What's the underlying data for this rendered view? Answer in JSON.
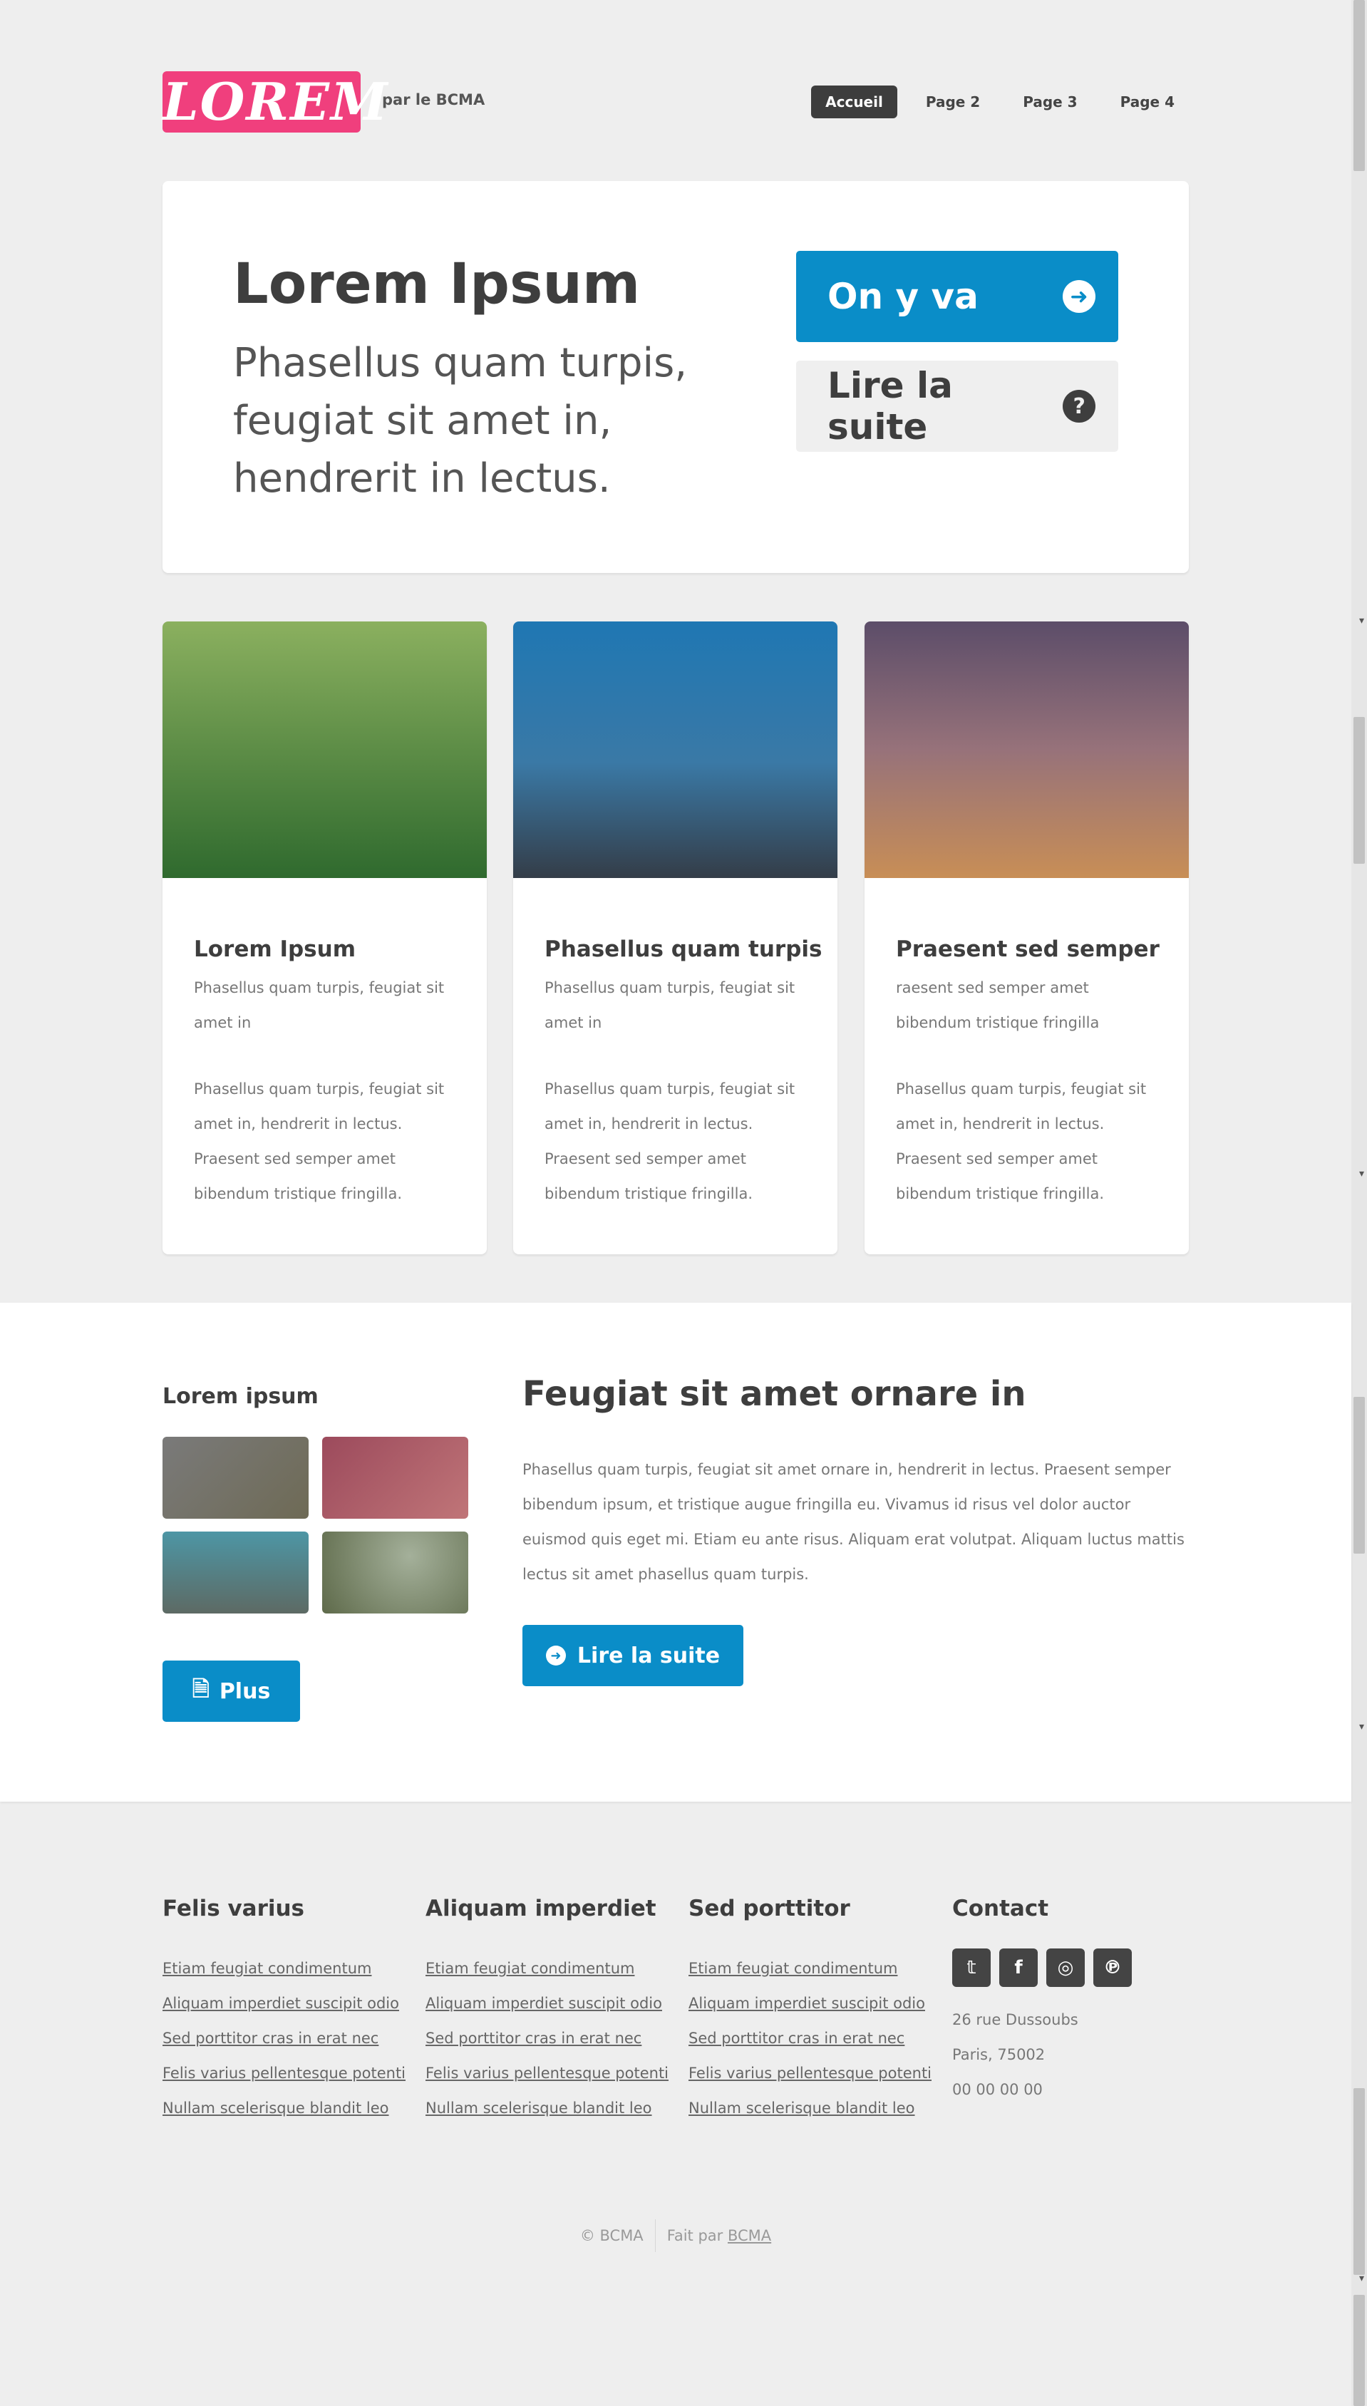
{
  "header": {
    "logo": "LOREM",
    "tagline": "par le BCMA",
    "nav": [
      {
        "label": "Accueil",
        "active": true
      },
      {
        "label": "Page 2",
        "active": false
      },
      {
        "label": "Page 3",
        "active": false
      },
      {
        "label": "Page 4",
        "active": false
      }
    ]
  },
  "hero": {
    "title": "Lorem Ipsum",
    "subtitle": "Phasellus quam turpis, feugiat sit amet in, hendrerit in lectus.",
    "primary_button": "On y va",
    "secondary_button": "Lire la suite"
  },
  "cards": [
    {
      "title": "Lorem Ipsum",
      "subtitle": "Phasellus quam turpis, feugiat sit amet in",
      "body": "Phasellus quam turpis, feugiat sit amet in, hendrerit in lectus. Praesent sed semper amet bibendum tristique fringilla."
    },
    {
      "title": "Phasellus quam turpis",
      "subtitle": "Phasellus quam turpis, feugiat sit amet in",
      "body": "Phasellus quam turpis, feugiat sit amet in, hendrerit in lectus. Praesent sed semper amet bibendum tristique fringilla."
    },
    {
      "title": "Praesent sed semper",
      "subtitle": "raesent sed semper amet bibendum tristique fringilla",
      "body": "Phasellus quam turpis, feugiat sit amet in, hendrerit in lectus. Praesent sed semper amet bibendum tristique fringilla."
    }
  ],
  "gallery": {
    "heading": "Lorem ipsum",
    "more_button": "Plus"
  },
  "feature": {
    "title": "Feugiat sit amet ornare in",
    "text": "Phasellus quam turpis, feugiat sit amet ornare in, hendrerit in lectus. Praesent semper bibendum ipsum, et tristique augue fringilla eu. Vivamus id risus vel dolor auctor euismod quis eget mi. Etiam eu ante risus. Aliquam erat volutpat. Aliquam luctus mattis lectus sit amet phasellus quam turpis.",
    "button": "Lire la suite"
  },
  "footer": {
    "columns": [
      {
        "title": "Felis varius",
        "links": [
          "Etiam feugiat condimentum",
          "Aliquam imperdiet suscipit odio",
          "Sed porttitor cras in erat nec",
          "Felis varius pellentesque potenti",
          "Nullam scelerisque blandit leo"
        ]
      },
      {
        "title": "Aliquam imperdiet",
        "links": [
          "Etiam feugiat condimentum",
          "Aliquam imperdiet suscipit odio",
          "Sed porttitor cras in erat nec",
          "Felis varius pellentesque potenti",
          "Nullam scelerisque blandit leo"
        ]
      },
      {
        "title": "Sed porttitor",
        "links": [
          "Etiam feugiat condimentum",
          "Aliquam imperdiet suscipit odio",
          "Sed porttitor cras in erat nec",
          "Felis varius pellentesque potenti",
          "Nullam scelerisque blandit leo"
        ]
      }
    ],
    "contact": {
      "title": "Contact",
      "social": [
        "twitter-icon",
        "facebook-icon",
        "instagram-icon",
        "pinterest-icon"
      ],
      "address": "26 rue Dussoubs",
      "city": "Paris, 75002",
      "phone": "00 00 00 00"
    },
    "copyright": "© BCMA",
    "made_by_prefix": "Fait par",
    "made_by_link": "BCMA"
  },
  "colors": {
    "brand_pink": "#f03f7d",
    "accent_blue": "#0a8dc8",
    "dark": "#3e3e3e"
  }
}
